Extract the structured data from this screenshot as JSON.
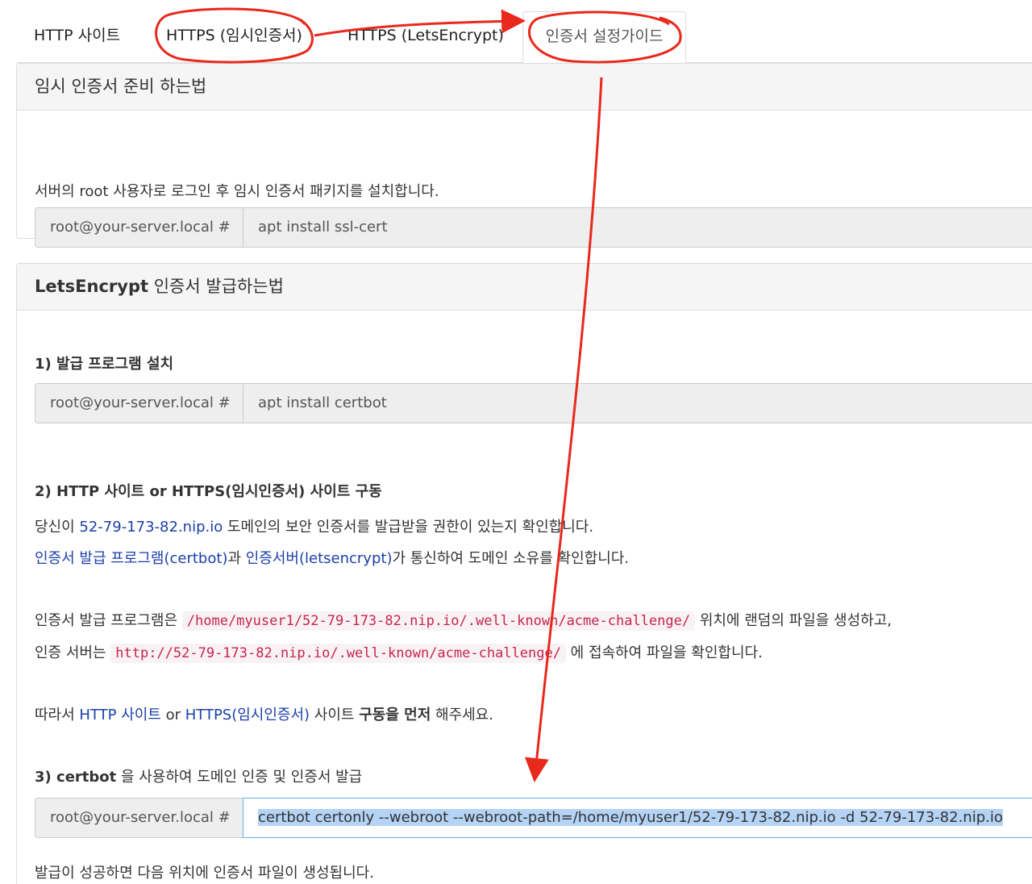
{
  "tabs": [
    {
      "label": "HTTP 사이트"
    },
    {
      "label": "HTTPS (임시인증서)"
    },
    {
      "label": "HTTPS (LetsEncrypt)"
    },
    {
      "label": "인증서 설정가이드",
      "active": true
    }
  ],
  "temp_panel": {
    "heading": "임시 인증서 준비 하는법",
    "description": "서버의 root 사용자로 로그인 후 임시 인증서 패키지를 설치합니다.",
    "prompt": "root@your-server.local #",
    "command": "apt install ssl-cert"
  },
  "le_panel": {
    "heading": "LetsEncrypt 인증서 발급하는법",
    "step1": {
      "title": "1) 발급 프로그램 설치",
      "prompt": "root@your-server.local #",
      "command": "apt install certbot"
    },
    "step2": {
      "title": "2) HTTP 사이트 or HTTPS(임시인증서) 사이트 구동",
      "line1_pre": "당신이 ",
      "line1_link": "52-79-173-82.nip.io",
      "line1_post": " 도메인의 보안 인증서를 발급받을 권한이 있는지 확인합니다.",
      "line2_link1": "인증서 발급 프로그램(certbot)",
      "line2_mid": "과 ",
      "line2_link2": "인증서버(letsencrypt)",
      "line2_post": "가 통신하여 도메인 소유를 확인합니다.",
      "line3_pre": "인증서 발급 프로그램은 ",
      "line3_code": "/home/myuser1/52-79-173-82.nip.io/.well-known/acme-challenge/",
      "line3_post": " 위치에 랜덤의 파일을 생성하고,",
      "line4_pre": "인증 서버는 ",
      "line4_code": "http://52-79-173-82.nip.io/.well-known/acme-challenge/",
      "line4_post": " 에 접속하여 파일을 확인합니다.",
      "line5_pre": "따라서 ",
      "line5_link1": "HTTP 사이트",
      "line5_or": " or ",
      "line5_link2": "HTTPS(임시인증서)",
      "line5_mid": " 사이트 ",
      "line5_bold": "구동을 먼저",
      "line5_post": " 해주세요."
    },
    "step3": {
      "title_bold": "3) certbot",
      "title_rest": " 을 사용하여 도메인 인증 및 인증서 발급",
      "prompt": "root@your-server.local #",
      "command": "certbot certonly --webroot --webroot-path=/home/myuser1/52-79-173-82.nip.io -d 52-79-173-82.nip.io",
      "result": "발급이 성공하면 다음 위치에 인증서 파일이 생성됩니다."
    }
  },
  "colors": {
    "annotation": "#e8291c",
    "link": "#1a3fa8",
    "code": "#c7254e"
  }
}
